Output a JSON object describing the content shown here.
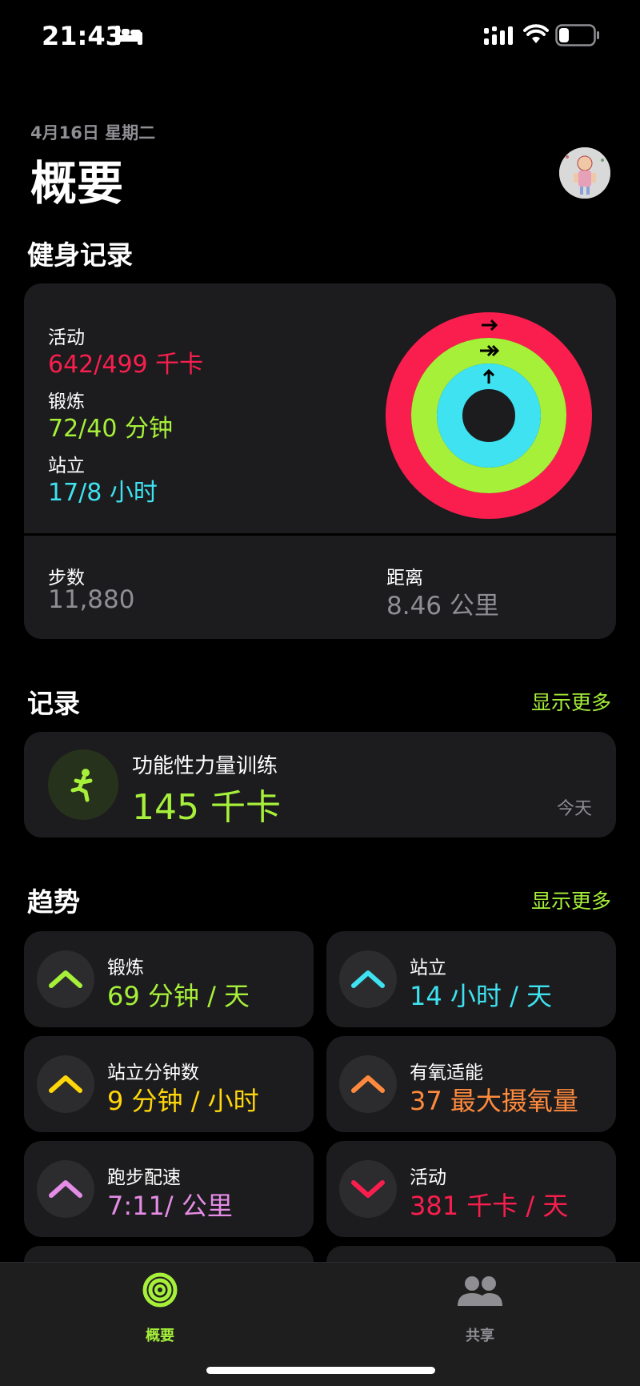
{
  "status_bar": {
    "time": "21:43"
  },
  "header": {
    "date": "4月16日 星期二",
    "title": "概要"
  },
  "fitness": {
    "section_title": "健身记录",
    "move": {
      "label": "活动",
      "value": "642/499 千卡",
      "progress": 1.29
    },
    "exercise": {
      "label": "锻炼",
      "value": "72/40 分钟",
      "progress": 1.8
    },
    "stand": {
      "label": "站立",
      "value": "17/8 小时",
      "progress": 2.13
    },
    "steps": {
      "label": "步数",
      "value": "11,880"
    },
    "distance": {
      "label": "距离",
      "value": "8.46 公里"
    },
    "colors": {
      "move": "#fa1e4e",
      "exercise": "#a6f03a",
      "stand": "#3ee2f0"
    }
  },
  "records": {
    "section_title": "记录",
    "show_more": "显示更多",
    "workout": {
      "name": "功能性力量训练",
      "value": "145 千卡",
      "date": "今天",
      "icon": "strength-training-icon"
    }
  },
  "trends": {
    "section_title": "趋势",
    "show_more": "显示更多",
    "items": [
      {
        "label": "锻炼",
        "value": "69 分钟 / 天",
        "direction": "up",
        "color": "#a6f03a"
      },
      {
        "label": "站立",
        "value": "14 小时 / 天",
        "direction": "up",
        "color": "#3ee2f0"
      },
      {
        "label": "站立分钟数",
        "value": "9 分钟 / 小时",
        "direction": "up",
        "color": "#ffd60a"
      },
      {
        "label": "有氧适能",
        "value": "37 最大摄氧量",
        "direction": "up",
        "color": "#ff8a3d"
      },
      {
        "label": "跑步配速",
        "value": "7:11/ 公里",
        "direction": "up",
        "color": "#e58ce6"
      },
      {
        "label": "活动",
        "value": "381 千卡 / 天",
        "direction": "down",
        "color": "#fa1e4e"
      }
    ]
  },
  "tab_bar": {
    "summary": {
      "label": "概要",
      "icon": "rings-icon",
      "active": true
    },
    "sharing": {
      "label": "共享",
      "icon": "people-icon",
      "active": false
    }
  }
}
